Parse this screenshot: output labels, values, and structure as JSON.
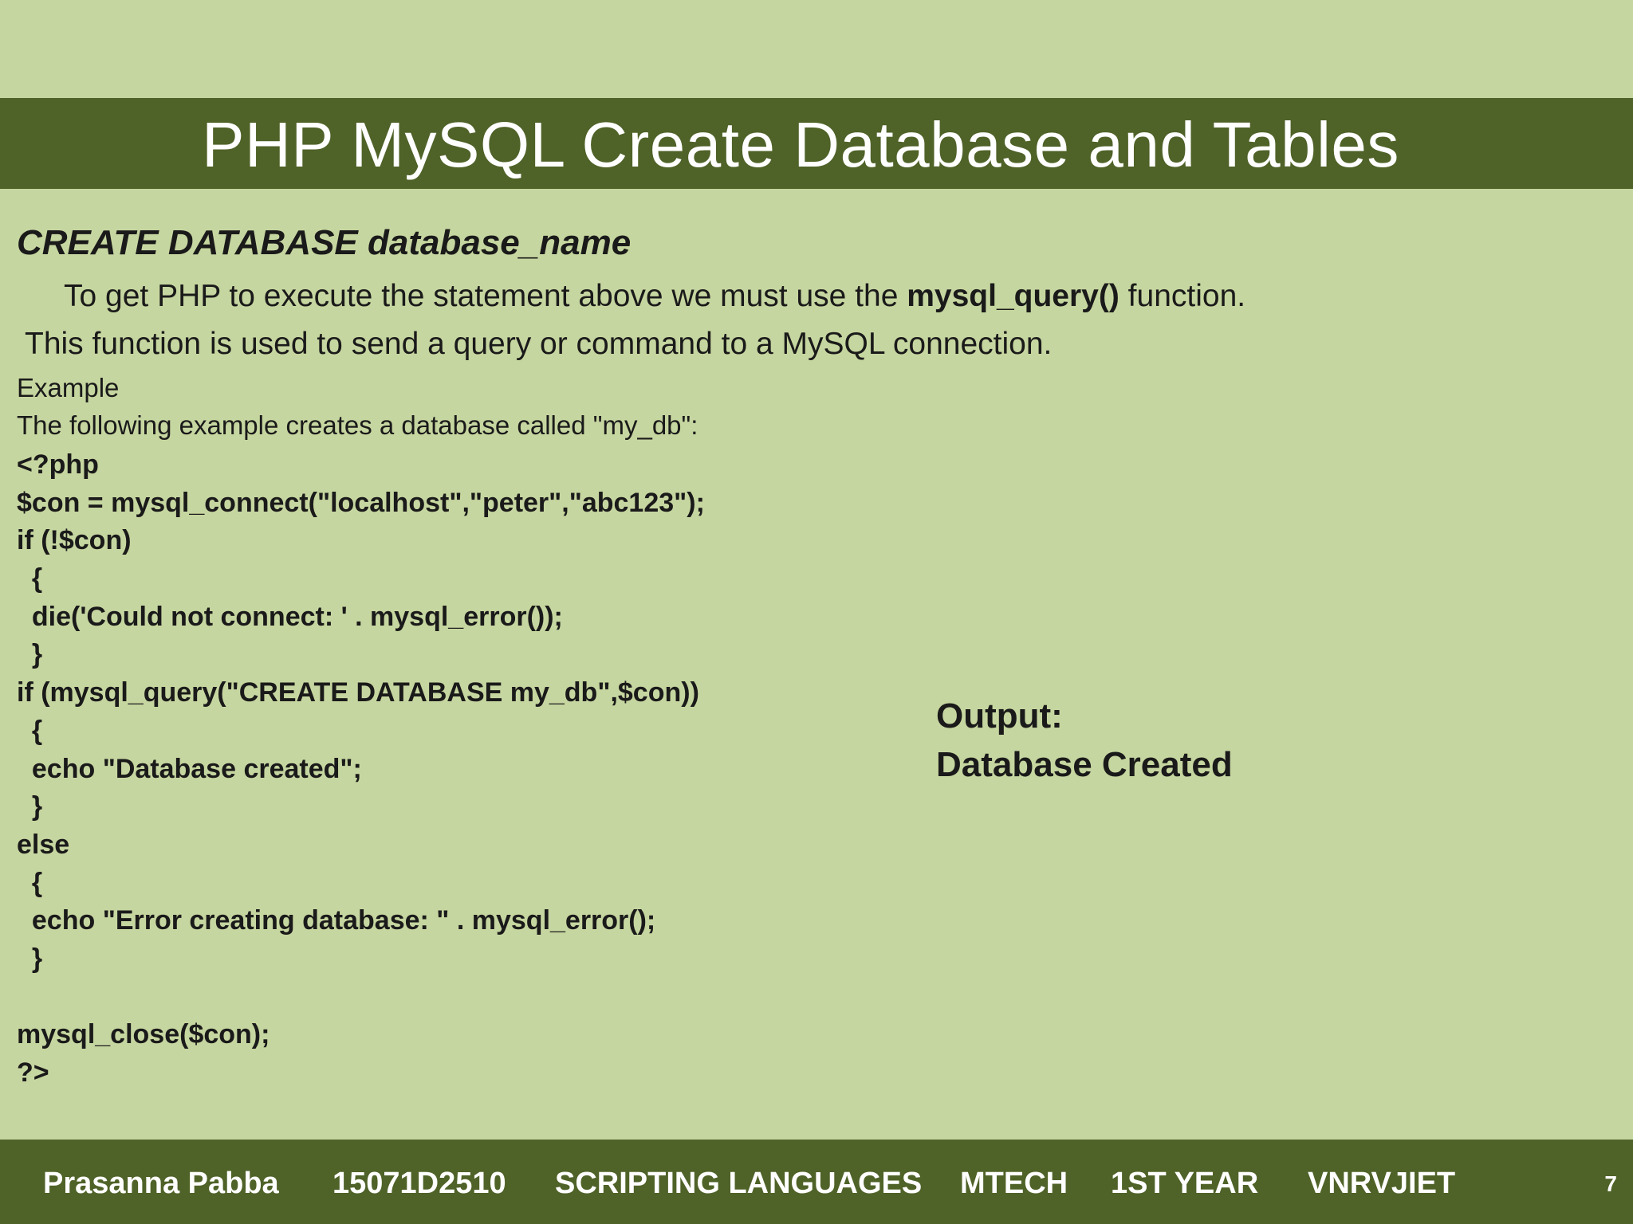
{
  "slide": {
    "title": "PHP MySQL Create Database and Tables",
    "heading": "CREATE DATABASE database_name",
    "paragraph1": {
      "before": "To get PHP to execute the statement above we must use the ",
      "bold": "mysql_query()",
      "after": " function."
    },
    "paragraph2": "This function is used to send a query or command to a MySQL connection.",
    "example_label": "Example",
    "example_description": "The following example creates a database called \"my_db\":",
    "code_lines": [
      "<?php",
      "$con = mysql_connect(\"localhost\",\"peter\",\"abc123\");",
      "if (!$con)",
      "  {",
      "  die('Could not connect: ' . mysql_error());",
      "  }",
      "if (mysql_query(\"CREATE DATABASE my_db\",$con))",
      "  {",
      "  echo \"Database created\";",
      "  }",
      "else",
      "  {",
      "  echo \"Error creating database: \" . mysql_error();",
      "  }",
      "",
      "mysql_close($con);",
      "?>"
    ],
    "output_label": "Output:",
    "output_value": "Database Created"
  },
  "footer": {
    "author": "Prasanna Pabba",
    "roll_number": "15071D2510",
    "subject": "SCRIPTING LANGUAGES",
    "course": "MTECH",
    "year": "1ST YEAR",
    "college": "VNRVJIET",
    "page_number": "7"
  },
  "colors": {
    "background": "#c6d6a0",
    "title_bar": "#4f6228",
    "footer_bar": "#4f6228",
    "title_text": "#ffffff",
    "body_text": "#1a1a1a"
  }
}
